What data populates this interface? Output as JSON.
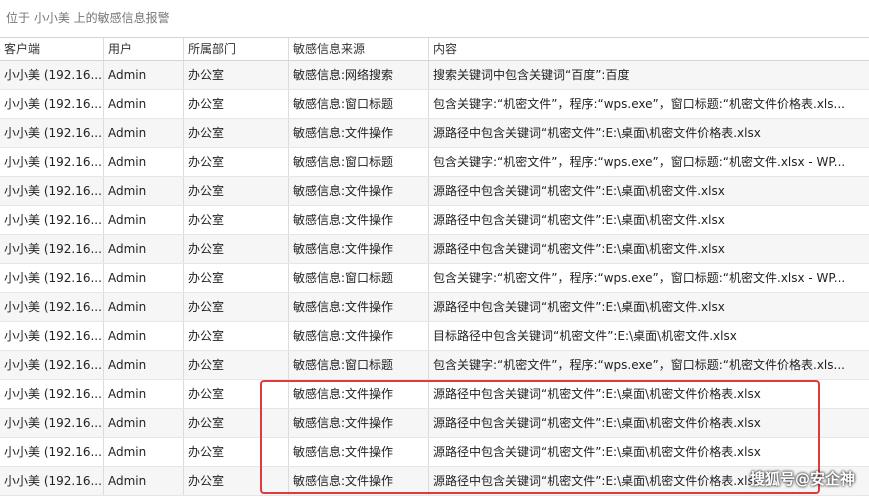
{
  "header": {
    "title": "位于 小小美 上的敏感信息报警"
  },
  "table": {
    "columns": [
      "客户端",
      "用户",
      "所属部门",
      "敏感信息来源",
      "内容"
    ],
    "rows": [
      [
        "小小美 (192.16...",
        "Admin",
        "办公室",
        "敏感信息:网络搜索",
        "搜索关键词中包含关键词“百度”:百度"
      ],
      [
        "小小美 (192.16...",
        "Admin",
        "办公室",
        "敏感信息:窗口标题",
        "包含关键字:“机密文件”，程序:“wps.exe”，窗口标题:“机密文件价格表.xls..."
      ],
      [
        "小小美 (192.16...",
        "Admin",
        "办公室",
        "敏感信息:文件操作",
        "源路径中包含关键词“机密文件”:E:\\桌面\\机密文件价格表.xlsx"
      ],
      [
        "小小美 (192.16...",
        "Admin",
        "办公室",
        "敏感信息:窗口标题",
        "包含关键字:“机密文件”，程序:“wps.exe”，窗口标题:“机密文件.xlsx - WP..."
      ],
      [
        "小小美 (192.16...",
        "Admin",
        "办公室",
        "敏感信息:文件操作",
        "源路径中包含关键词“机密文件”:E:\\桌面\\机密文件.xlsx"
      ],
      [
        "小小美 (192.16...",
        "Admin",
        "办公室",
        "敏感信息:文件操作",
        "源路径中包含关键词“机密文件”:E:\\桌面\\机密文件.xlsx"
      ],
      [
        "小小美 (192.16...",
        "Admin",
        "办公室",
        "敏感信息:文件操作",
        "源路径中包含关键词“机密文件”:E:\\桌面\\机密文件.xlsx"
      ],
      [
        "小小美 (192.16...",
        "Admin",
        "办公室",
        "敏感信息:窗口标题",
        "包含关键字:“机密文件”，程序:“wps.exe”，窗口标题:“机密文件.xlsx - WP..."
      ],
      [
        "小小美 (192.16...",
        "Admin",
        "办公室",
        "敏感信息:文件操作",
        "源路径中包含关键词“机密文件”:E:\\桌面\\机密文件.xlsx"
      ],
      [
        "小小美 (192.16...",
        "Admin",
        "办公室",
        "敏感信息:文件操作",
        "目标路径中包含关键词“机密文件”:E:\\桌面\\机密文件.xlsx"
      ],
      [
        "小小美 (192.16...",
        "Admin",
        "办公室",
        "敏感信息:窗口标题",
        "包含关键字:“机密文件”，程序:“wps.exe”，窗口标题:“机密文件价格表.xls..."
      ],
      [
        "小小美 (192.16...",
        "Admin",
        "办公室",
        "敏感信息:文件操作",
        "源路径中包含关键词“机密文件”:E:\\桌面\\机密文件价格表.xlsx"
      ],
      [
        "小小美 (192.16...",
        "Admin",
        "办公室",
        "敏感信息:文件操作",
        "源路径中包含关键词“机密文件”:E:\\桌面\\机密文件价格表.xlsx"
      ],
      [
        "小小美 (192.16...",
        "Admin",
        "办公室",
        "敏感信息:文件操作",
        "源路径中包含关键词“机密文件”:E:\\桌面\\机密文件价格表.xlsx"
      ],
      [
        "小小美 (192.16...",
        "Admin",
        "办公室",
        "敏感信息:文件操作",
        "源路径中包含关键词“机密文件”:E:\\桌面\\机密文件价格表.xlsx"
      ]
    ]
  },
  "watermark": {
    "text": "搜狐号@安企神"
  },
  "colors": {
    "highlight_border": "#e03a3a",
    "row_alt": "#f6f6f6"
  }
}
